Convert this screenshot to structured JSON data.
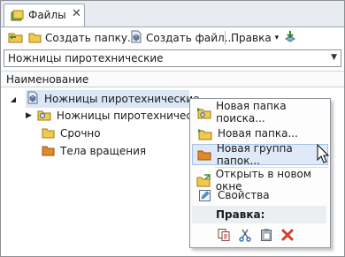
{
  "tab": {
    "label": "Файлы",
    "close": "✕"
  },
  "toolbar": {
    "create_folder": "Создать папку...",
    "create_file": "Создать файл...",
    "edit": "Правка",
    "edit_arrow": "▾"
  },
  "combo": {
    "value": "Ножницы пиротехнические",
    "arrow": "▼"
  },
  "column_header": "Наименование",
  "tree": {
    "root": "Ножницы пиротехнические",
    "children": [
      "Ножницы пиротехнические",
      "Срочно",
      "Тела вращения"
    ]
  },
  "context_menu": {
    "items": [
      "Новая папка поиска...",
      "Новая папка...",
      "Новая группа папок...",
      "Открыть в новом окне",
      "Свойства"
    ],
    "edit_section": "Правка:",
    "edit_icons": [
      "copy-icon",
      "cut-icon",
      "paste-icon",
      "delete-icon"
    ]
  },
  "colors": {
    "selection": "#dbe6f6",
    "highlight": "#dfe9f7",
    "folder": "#f0c040",
    "folder_orange": "#e08a2c"
  }
}
